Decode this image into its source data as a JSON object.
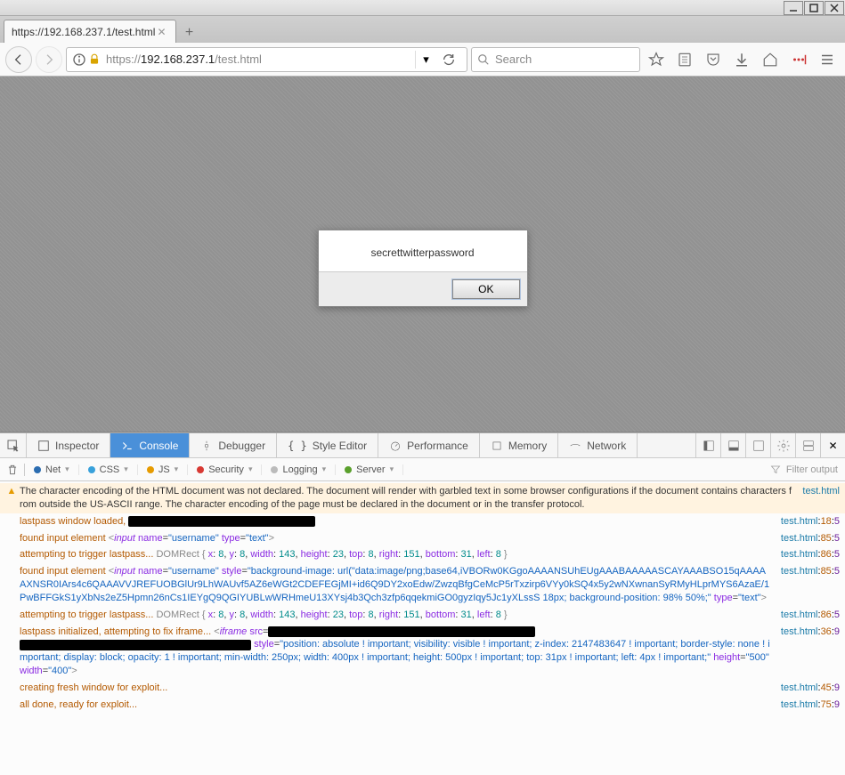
{
  "window_controls": {
    "minimize": "_",
    "maximize": "◻",
    "close": "✕"
  },
  "tab": {
    "title": "https://192.168.237.1/test.html",
    "new_tab": "+"
  },
  "url": {
    "protocol": "https://",
    "host": "192.168.237.1",
    "path": "/test.html"
  },
  "search": {
    "placeholder": "Search"
  },
  "alert": {
    "message": "secrettwitterpassword",
    "ok": "OK"
  },
  "devtools": {
    "tabs": {
      "inspector": "Inspector",
      "console": "Console",
      "debugger": "Debugger",
      "style": "Style Editor",
      "perf": "Performance",
      "memory": "Memory",
      "network": "Network"
    },
    "filters": {
      "net": "Net",
      "css": "CSS",
      "js": "JS",
      "security": "Security",
      "logging": "Logging",
      "server": "Server",
      "filter_placeholder": "Filter output"
    },
    "rows": [
      {
        "type": "warn",
        "msg_a": "The character encoding of the HTML document was not declared. The document will render with garbled text in some browser configurations if the document contains characters from outside the US-ASCII range. The character encoding of the page must be declared in the document or in the transfer protocol.",
        "file": "test.html"
      },
      {
        "msg_a": "lastpass window loaded, ",
        "redact": 210,
        "file": "test.html",
        "line": "18",
        "col": "5"
      },
      {
        "msg_a": "found input element ",
        "tag": "input",
        "attrs": "name=\"username\" type=\"text\"",
        "file": "test.html",
        "line": "85",
        "col": "5"
      },
      {
        "msg_a": "attempting to trigger lastpass... ",
        "domrect": "DOMRect { x: 8, y: 8, width: 143, height: 23, top: 8, right: 151, bottom: 31, left: 8 }",
        "file": "test.html",
        "line": "86",
        "col": "5"
      },
      {
        "msg_a": "found input element ",
        "tag": "input",
        "attrs": "name=\"username\" style=\"background-image: url(&quot;data:image/png;base64,iVBORw0KGgoAAAANSUhEUgAAABAAAAASCAYAAABSO15qAAAAAXNSR0IArs4c6QAAAVVJREFUOBGlUr9LhWAUvf5AZ6eWGt2CDEFEGjMI+id6Q9DY2xoEdw/ZwzqBfgCeMcP5rTxzirp6VYy0kSQ4x5y2wNXwnanSyRMyHLprMYS6AzaE/1PwBFFGkS1yXbNs2eZ5Hpmn26nCs1IEYgQ9QGIYUBLwWRHmeU13XYsj4b3Qch3zfp6qqekmiGO0gyzIqy5Jc1yXLssS 18px; background-position: 98% 50%;\" type=\"text\"",
        "file": "test.html",
        "line": "85",
        "col": "5"
      },
      {
        "msg_a": "attempting to trigger lastpass... ",
        "domrect": "DOMRect { x: 8, y: 8, width: 143, height: 23, top: 8, right: 151, bottom: 31, left: 8 }",
        "file": "test.html",
        "line": "86",
        "col": "5"
      },
      {
        "msg_a": "lastpass initialized, attempting to fix iframe... ",
        "tag": "iframe",
        "redact_inline": 300,
        "redact_below": 260,
        "attrs_after": "style=\"position: absolute ! important; visibility: visible ! important; z-index: 2147483647 ! important; border-style: none ! important; display: block; opacity: 1 ! important; min-width: 250px; width: 400px ! important; height: 500px ! important; top: 31px ! important; left: 4px ! important;\" height=\"500\" width=\"400\"",
        "file": "test.html",
        "line": "36",
        "col": "9"
      },
      {
        "msg_a": "creating fresh window for exploit...",
        "file": "test.html",
        "line": "45",
        "col": "9"
      },
      {
        "msg_a": "all done, ready for exploit...",
        "file": "test.html",
        "line": "75",
        "col": "9"
      }
    ]
  }
}
